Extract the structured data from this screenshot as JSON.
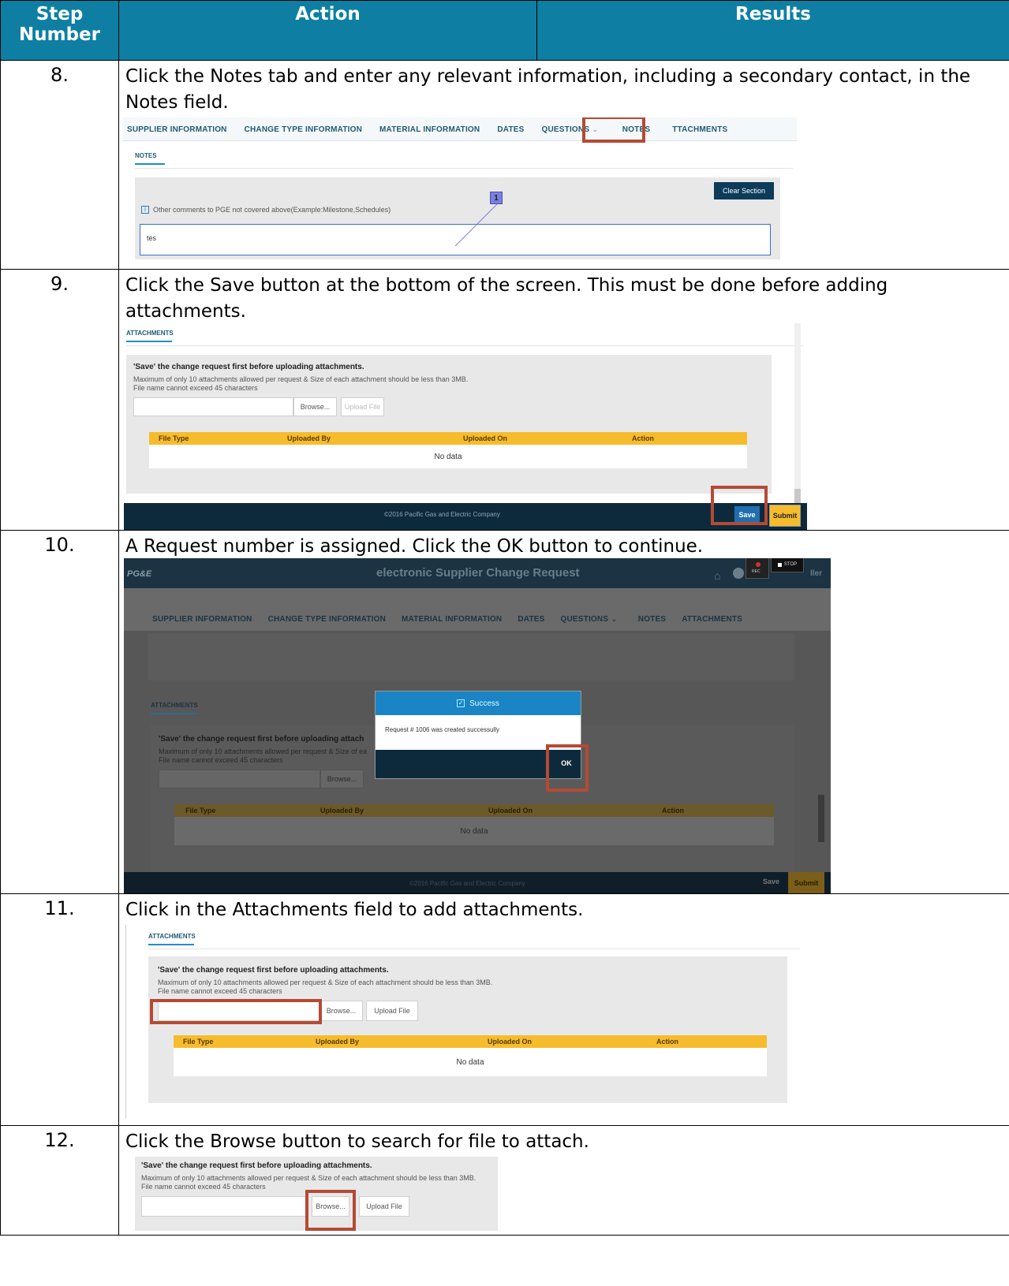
{
  "headers": {
    "step": "Step Number",
    "action": "Action",
    "results": "Results"
  },
  "steps": [
    {
      "number": "8.",
      "action": "Click the Notes tab and enter any relevant information, including a secondary contact, in the Notes field."
    },
    {
      "number": "9.",
      "action": "Click the Save button at the bottom of the screen. This must be done before adding attachments."
    },
    {
      "number": "10.",
      "action": "A Request number is assigned. Click the OK button to continue."
    },
    {
      "number": "11.",
      "action": "Click in the Attachments field to add attachments."
    },
    {
      "number": "12.",
      "action": "Click the Browse button to search for file to attach."
    }
  ],
  "tabs": [
    "SUPPLIER INFORMATION",
    "CHANGE TYPE INFORMATION",
    "MATERIAL INFORMATION",
    "DATES",
    "QUESTIONS",
    "NOTES",
    "ATTACHMENTS"
  ],
  "tabs_cropped_attachments": "TTACHMENTS",
  "notes_shot": {
    "section_label": "NOTES",
    "clear_button": "Clear Section",
    "info_text": "Other comments to PGE not covered above(Example:Milestone,Schedules)",
    "input_value": "tes",
    "callout_number": "1"
  },
  "attach": {
    "section_label": "ATTACHMENTS",
    "warning": "'Save' the change request first before uploading attachments.",
    "info_line1": "Maximum of only 10 attachments allowed per request & Size of each attachment should be less than 3MB.",
    "info_line2": "File name cannot exceed 45 characters",
    "browse": "Browse...",
    "upload": "Upload File",
    "columns": [
      "File Type",
      "Uploaded By",
      "Uploaded On",
      "Action"
    ],
    "no_data": "No data",
    "warning_cropped": "'Save' the change request first before uploading attach",
    "info_line1_cropped": "Maximum of only 10 attachments allowed per request & Size of ea"
  },
  "footer": {
    "copyright": "©2016 Pacific Gas and Electric Company",
    "save": "Save",
    "submit": "Submit"
  },
  "app": {
    "logo": "PG&E",
    "title": "electronic Supplier Change Request",
    "user_fragment": "ller",
    "rec": "REC",
    "stop": "STOP"
  },
  "dialog": {
    "title": "Success",
    "message": "Request # 1006 was created successully",
    "ok": "OK"
  },
  "colors": {
    "header_bg": "#0e7fa2",
    "highlight": "#b54a34",
    "table_head": "#f6bc2d",
    "footer_bg": "#0d2a3d"
  }
}
